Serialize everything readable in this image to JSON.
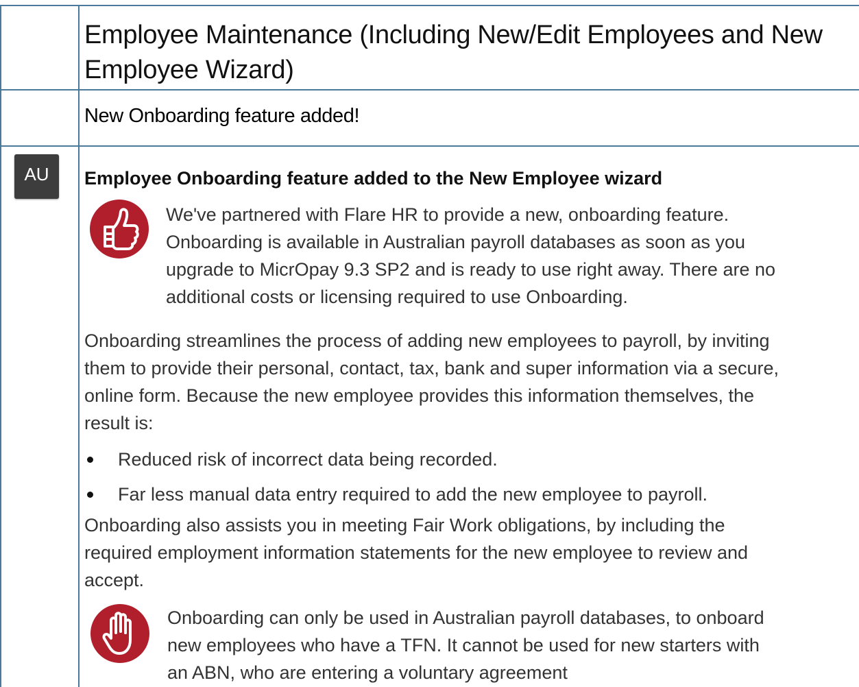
{
  "document": {
    "title": {
      "line1": "Employee Maintenance (Including New/Edit Employees and New",
      "line2": "Employee Wizard)"
    },
    "subtitle": "New Onboarding feature added!",
    "region_badge": "AU",
    "section": {
      "heading": "Employee Onboarding feature added to the New Employee wizard",
      "tip_icon": "thumbs-up-icon",
      "tip_lines": [
        "We've partnered with Flare HR to provide a new, onboarding feature.",
        "Onboarding is available in Australian payroll databases as soon as you",
        "upgrade to MicrOpay 9.3 SP2 and is ready to use right away. There are no",
        "additional costs or licensing required to use Onboarding."
      ],
      "intro_lines": [
        "Onboarding streamlines the process of adding new employees to payroll, by inviting",
        "them to provide their personal, contact, tax, bank and super information via a secure,",
        "online form.  Because the new employee provides this information themselves, the",
        "result is:"
      ],
      "bullets": [
        "Reduced risk of incorrect data being recorded.",
        "Far less manual data entry required to add the new employee to payroll."
      ],
      "fairwork_lines": [
        "Onboarding also assists you in meeting Fair Work obligations, by including the",
        "required employment information statements for the new employee to review and",
        "accept."
      ],
      "warning_icon": "stop-hand-icon",
      "warning_lines": [
        "Onboarding can only be used in Australian payroll databases, to onboard",
        "new employees who have a TFN. It cannot be used for new starters with",
        "an ABN, who are entering a voluntary agreement"
      ]
    },
    "colors": {
      "border": "#4a7a9a",
      "icon_red": "#b11f2c",
      "badge_bg": "#3d3d3d"
    }
  }
}
